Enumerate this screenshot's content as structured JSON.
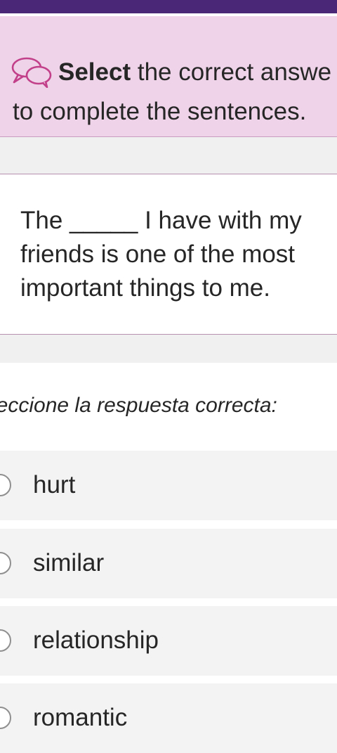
{
  "instruction": {
    "bold": "Select",
    "rest_line1": " the correct answe",
    "line2": "to complete the sentences."
  },
  "question": {
    "text": "The _____ I have with my friends is one of the most important things to me."
  },
  "prompt": "leccione la respuesta correcta:",
  "options": [
    {
      "label": "hurt"
    },
    {
      "label": "similar"
    },
    {
      "label": "relationship"
    },
    {
      "label": "romantic"
    }
  ],
  "colors": {
    "top_bar": "#4b2778",
    "instruction_bg": "#efd3e8",
    "icon_stroke": "#c2408a",
    "option_bg": "#f3f3f3"
  }
}
